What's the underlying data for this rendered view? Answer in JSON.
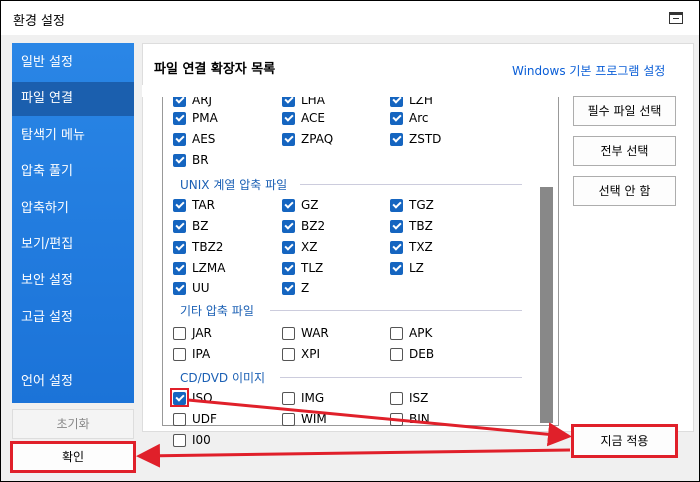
{
  "window": {
    "title": "환경 설정"
  },
  "sidebar": {
    "items": [
      {
        "label": "일반 설정",
        "active": false
      },
      {
        "label": "파일 연결",
        "active": true
      },
      {
        "label": "탐색기 메뉴",
        "active": false
      },
      {
        "label": "압축 풀기",
        "active": false
      },
      {
        "label": "압축하기",
        "active": false
      },
      {
        "label": "보기/편집",
        "active": false
      },
      {
        "label": "보안 설정",
        "active": false
      },
      {
        "label": "고급 설정",
        "active": false
      },
      {
        "label": "언어 설정",
        "active": false
      }
    ],
    "reset_label": "초기화",
    "ok_label": "확인"
  },
  "main": {
    "title": "파일 연결 확장자 목록",
    "link": "Windows 기본 프로그램 설정",
    "buttons": {
      "required": "필수 파일 선택",
      "select_all": "전부 선택",
      "select_none": "선택 안 함",
      "apply_now": "지금 적용"
    },
    "groups": {
      "unix": "UNIX 계열 압축 파일",
      "other": "기타 압축 파일",
      "cd": "CD/DVD 이미지"
    },
    "extensions": {
      "r0": [
        "ARJ",
        "LHA",
        "LZH"
      ],
      "r1": [
        "PMA",
        "ACE",
        "Arc"
      ],
      "r2": [
        "AES",
        "ZPAQ",
        "ZSTD"
      ],
      "r3": [
        "BR"
      ],
      "u0": [
        "TAR",
        "GZ",
        "TGZ"
      ],
      "u1": [
        "BZ",
        "BZ2",
        "TBZ"
      ],
      "u2": [
        "TBZ2",
        "XZ",
        "TXZ"
      ],
      "u3": [
        "LZMA",
        "TLZ",
        "LZ"
      ],
      "u4": [
        "UU",
        "Z"
      ],
      "o0": [
        "JAR",
        "WAR",
        "APK"
      ],
      "o1": [
        "IPA",
        "XPI",
        "DEB"
      ],
      "c0": [
        "ISO",
        "IMG",
        "ISZ"
      ],
      "c1": [
        "UDF",
        "WIM",
        "BIN"
      ],
      "c2": [
        "I00"
      ]
    }
  },
  "colors": {
    "accent": "#1565c0",
    "sidebar": "#2a86e6",
    "highlight": "#e0202a"
  }
}
